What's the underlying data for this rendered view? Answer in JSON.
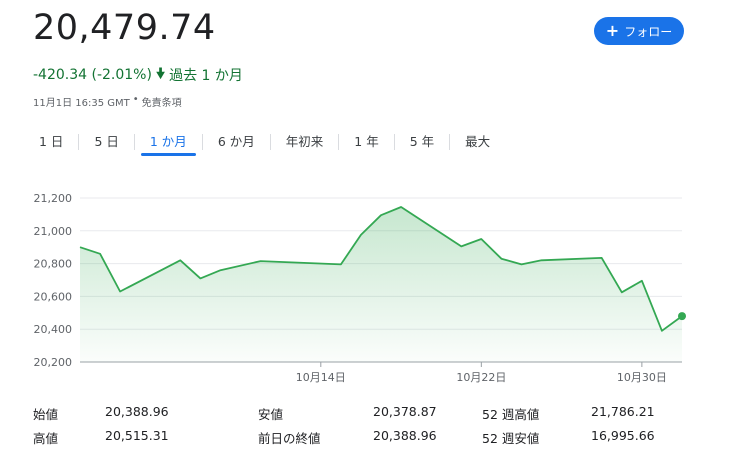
{
  "header": {
    "price": "20,479.74",
    "change": "-420.34 (-2.01%)",
    "period": "過去 1 か月",
    "timestamp": "11月1日 16:35 GMT",
    "bullet": "•",
    "disclaimer": "免責条項",
    "follow_label": "フォロー",
    "follow_icon": "plus-icon",
    "down_icon": "arrow-down-icon",
    "color_negative": "#137333",
    "color_accent": "#1a73e8"
  },
  "ranges": [
    {
      "label": "1 日",
      "active": false
    },
    {
      "label": "5 日",
      "active": false
    },
    {
      "label": "1 か月",
      "active": true
    },
    {
      "label": "6 か月",
      "active": false
    },
    {
      "label": "年初来",
      "active": false
    },
    {
      "label": "1 年",
      "active": false
    },
    {
      "label": "5 年",
      "active": false
    },
    {
      "label": "最大",
      "active": false
    }
  ],
  "chart_data": {
    "type": "area",
    "line_color": "#34a853",
    "ylim": [
      20200,
      21200
    ],
    "yticks": [
      {
        "value": 20200,
        "label": "20,200"
      },
      {
        "value": 20400,
        "label": "20,400"
      },
      {
        "value": 20600,
        "label": "20,600"
      },
      {
        "value": 20800,
        "label": "20,800"
      },
      {
        "value": 21000,
        "label": "21,000"
      },
      {
        "value": 21200,
        "label": "21,200"
      }
    ],
    "xrange": [
      "2024-10-02",
      "2024-11-01"
    ],
    "xticks": [
      {
        "date": "2024-10-14",
        "label": "10月14日"
      },
      {
        "date": "2024-10-22",
        "label": "10月22日"
      },
      {
        "date": "2024-10-30",
        "label": "10月30日"
      }
    ],
    "grid": true,
    "points": [
      {
        "x": "2024-10-02",
        "y": 20900
      },
      {
        "x": "2024-10-03",
        "y": 20860
      },
      {
        "x": "2024-10-04",
        "y": 20630
      },
      {
        "x": "2024-10-07",
        "y": 20820
      },
      {
        "x": "2024-10-08",
        "y": 20710
      },
      {
        "x": "2024-10-09",
        "y": 20760
      },
      {
        "x": "2024-10-11",
        "y": 20815
      },
      {
        "x": "2024-10-15",
        "y": 20795
      },
      {
        "x": "2024-10-16",
        "y": 20975
      },
      {
        "x": "2024-10-17",
        "y": 21095
      },
      {
        "x": "2024-10-18",
        "y": 21145
      },
      {
        "x": "2024-10-21",
        "y": 20905
      },
      {
        "x": "2024-10-22",
        "y": 20950
      },
      {
        "x": "2024-10-23",
        "y": 20830
      },
      {
        "x": "2024-10-24",
        "y": 20795
      },
      {
        "x": "2024-10-25",
        "y": 20820
      },
      {
        "x": "2024-10-28",
        "y": 20835
      },
      {
        "x": "2024-10-29",
        "y": 20625
      },
      {
        "x": "2024-10-30",
        "y": 20695
      },
      {
        "x": "2024-10-31",
        "y": 20390
      },
      {
        "x": "2024-11-01",
        "y": 20479.74
      }
    ]
  },
  "stats": [
    {
      "label": "始値",
      "value": "20,388.96"
    },
    {
      "label": "安値",
      "value": "20,378.87"
    },
    {
      "label": "52 週高値",
      "value": "21,786.21"
    },
    {
      "label": "高値",
      "value": "20,515.31"
    },
    {
      "label": "前日の終値",
      "value": "20,388.96"
    },
    {
      "label": "52 週安値",
      "value": "16,995.66"
    }
  ]
}
